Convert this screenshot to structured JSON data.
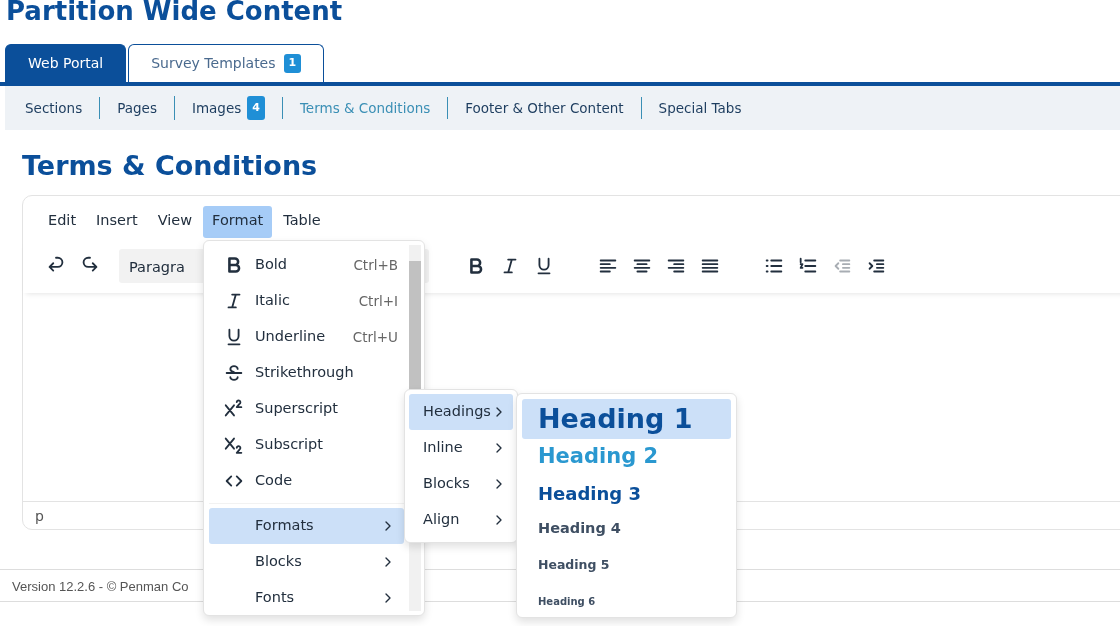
{
  "page_title": "Partition Wide Content",
  "tabs": [
    {
      "label": "Web Portal",
      "selected": true
    },
    {
      "label": "Survey Templates",
      "badge": "1",
      "selected": false
    }
  ],
  "subnav": [
    {
      "label": "Sections",
      "selected": false
    },
    {
      "label": "Pages",
      "selected": false
    },
    {
      "label": "Images",
      "badge": "4",
      "selected": false
    },
    {
      "label": "Terms & Conditions",
      "selected": true
    },
    {
      "label": "Footer & Other Content",
      "selected": false
    },
    {
      "label": "Special Tabs",
      "selected": false
    }
  ],
  "section_title": "Terms & Conditions",
  "editor": {
    "menubar": [
      {
        "label": "Edit",
        "selected": false
      },
      {
        "label": "Insert",
        "selected": false
      },
      {
        "label": "View",
        "selected": false
      },
      {
        "label": "Format",
        "selected": true
      },
      {
        "label": "Table",
        "selected": false
      }
    ],
    "block_select": "Paragra",
    "toolbar": [
      {
        "kind": "undo",
        "disabled": false
      },
      {
        "kind": "redo",
        "disabled": false
      },
      {
        "kind": "bold",
        "disabled": false
      },
      {
        "kind": "italic",
        "disabled": false
      },
      {
        "kind": "underline",
        "disabled": false
      },
      {
        "kind": "align-left",
        "disabled": false
      },
      {
        "kind": "align-center",
        "disabled": false
      },
      {
        "kind": "align-right",
        "disabled": false
      },
      {
        "kind": "justify",
        "disabled": false
      },
      {
        "kind": "bullet-list",
        "disabled": false
      },
      {
        "kind": "numbered-list",
        "disabled": false
      },
      {
        "kind": "outdent",
        "disabled": true
      },
      {
        "kind": "indent",
        "disabled": false
      }
    ],
    "status_path": "p"
  },
  "format_menu": [
    {
      "kind": "bold",
      "label": "Bold",
      "shortcut": "Ctrl+B",
      "selected": false
    },
    {
      "kind": "italic",
      "label": "Italic",
      "shortcut": "Ctrl+I",
      "selected": false
    },
    {
      "kind": "underline",
      "label": "Underline",
      "shortcut": "Ctrl+U",
      "selected": false
    },
    {
      "kind": "strikethrough",
      "label": "Strikethrough",
      "selected": false
    },
    {
      "kind": "superscript",
      "label": "Superscript",
      "selected": false
    },
    {
      "kind": "subscript",
      "label": "Subscript",
      "selected": false
    },
    {
      "kind": "code",
      "label": "Code",
      "selected": false
    },
    {
      "kind": "submenu",
      "label": "Formats",
      "selected": true
    },
    {
      "kind": "submenu",
      "label": "Blocks",
      "selected": false
    },
    {
      "kind": "submenu",
      "label": "Fonts",
      "selected": false
    }
  ],
  "formats_submenu": [
    {
      "label": "Headings",
      "selected": true
    },
    {
      "label": "Inline",
      "selected": false
    },
    {
      "label": "Blocks",
      "selected": false
    },
    {
      "label": "Align",
      "selected": false
    }
  ],
  "headings_submenu": [
    {
      "kind": "h1",
      "label": "Heading 1",
      "selected": true
    },
    {
      "kind": "h2",
      "label": "Heading 2",
      "selected": false
    },
    {
      "kind": "h3",
      "label": "Heading 3",
      "selected": false
    },
    {
      "kind": "h4",
      "label": "Heading 4",
      "selected": false
    },
    {
      "kind": "h5",
      "label": "Heading 5",
      "selected": false
    },
    {
      "kind": "h6",
      "label": "Heading 6",
      "selected": false
    }
  ],
  "footer": "Version 12.2.6 - © Penman Co"
}
